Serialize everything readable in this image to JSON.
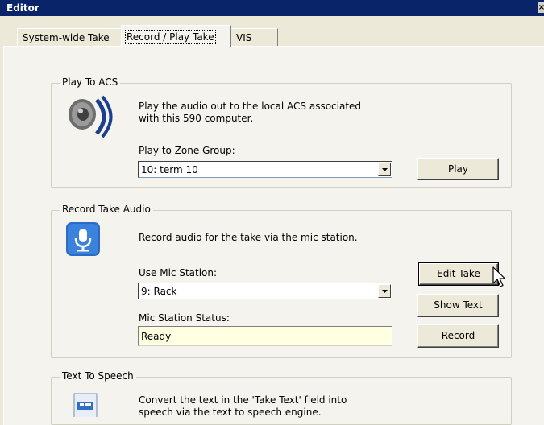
{
  "window": {
    "title": "Editor"
  },
  "tabs": [
    {
      "label": "System-wide Take"
    },
    {
      "label": "Record / Play Take"
    },
    {
      "label": "VIS"
    }
  ],
  "play_to_acs": {
    "legend": "Play To ACS",
    "description_line1": "Play the audio out to the local ACS associated",
    "description_line2": "with this 590 computer.",
    "zone_group_label": "Play to Zone Group:",
    "zone_group_value": "10: term 10",
    "play_button": "Play"
  },
  "record_take_audio": {
    "legend": "Record Take Audio",
    "description": "Record audio for the take via the mic station.",
    "mic_station_label": "Use Mic Station:",
    "mic_station_value": "9: Rack",
    "status_label": "Mic Station Status:",
    "status_value": "Ready",
    "edit_take_button": "Edit Take",
    "show_text_button": "Show Text",
    "record_button": "Record"
  },
  "text_to_speech": {
    "legend": "Text To Speech",
    "description_line1": "Convert the text in the 'Take Text' field into",
    "description_line2": "speech via the text to speech engine."
  },
  "icons": {
    "speaker": "speaker-icon",
    "microphone": "microphone-icon",
    "tts": "document-speech-icon",
    "cursor": "mouse-cursor-icon"
  }
}
